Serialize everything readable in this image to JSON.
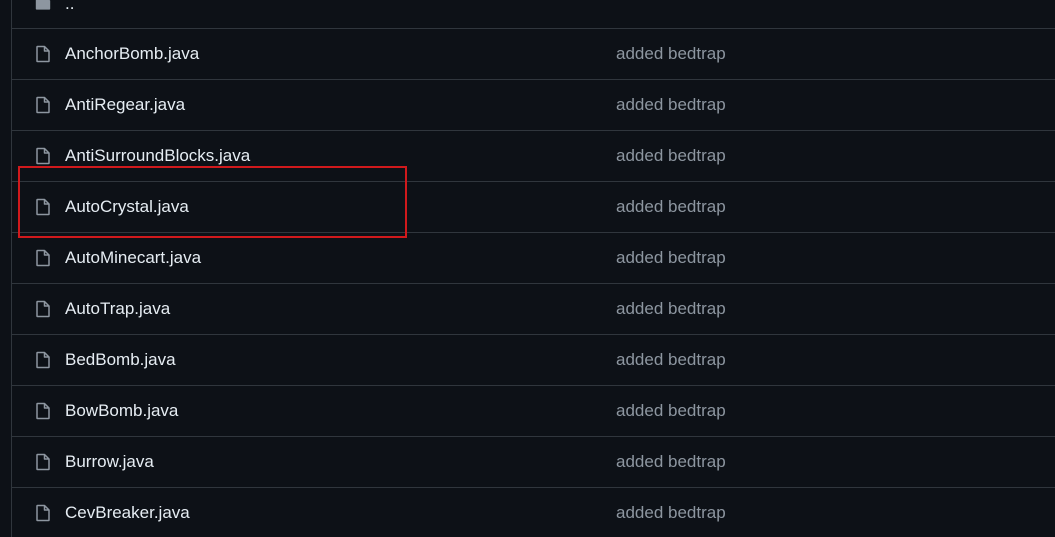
{
  "parent_dir": {
    "label": "..",
    "icon": "folder-icon"
  },
  "files": [
    {
      "name": "AnchorBomb.java",
      "commit_message": "added bedtrap",
      "icon": "file-icon"
    },
    {
      "name": "AntiRegear.java",
      "commit_message": "added bedtrap",
      "icon": "file-icon"
    },
    {
      "name": "AntiSurroundBlocks.java",
      "commit_message": "added bedtrap",
      "icon": "file-icon"
    },
    {
      "name": "AutoCrystal.java",
      "commit_message": "added bedtrap",
      "icon": "file-icon",
      "highlighted": true
    },
    {
      "name": "AutoMinecart.java",
      "commit_message": "added bedtrap",
      "icon": "file-icon"
    },
    {
      "name": "AutoTrap.java",
      "commit_message": "added bedtrap",
      "icon": "file-icon"
    },
    {
      "name": "BedBomb.java",
      "commit_message": "added bedtrap",
      "icon": "file-icon"
    },
    {
      "name": "BowBomb.java",
      "commit_message": "added bedtrap",
      "icon": "file-icon"
    },
    {
      "name": "Burrow.java",
      "commit_message": "added bedtrap",
      "icon": "file-icon"
    },
    {
      "name": "CevBreaker.java",
      "commit_message": "added bedtrap",
      "icon": "file-icon"
    }
  ],
  "colors": {
    "background": "#0d1117",
    "border": "#30363d",
    "file_name": "#e6edf3",
    "commit_message": "#8d96a0",
    "highlight": "#d0191c"
  }
}
